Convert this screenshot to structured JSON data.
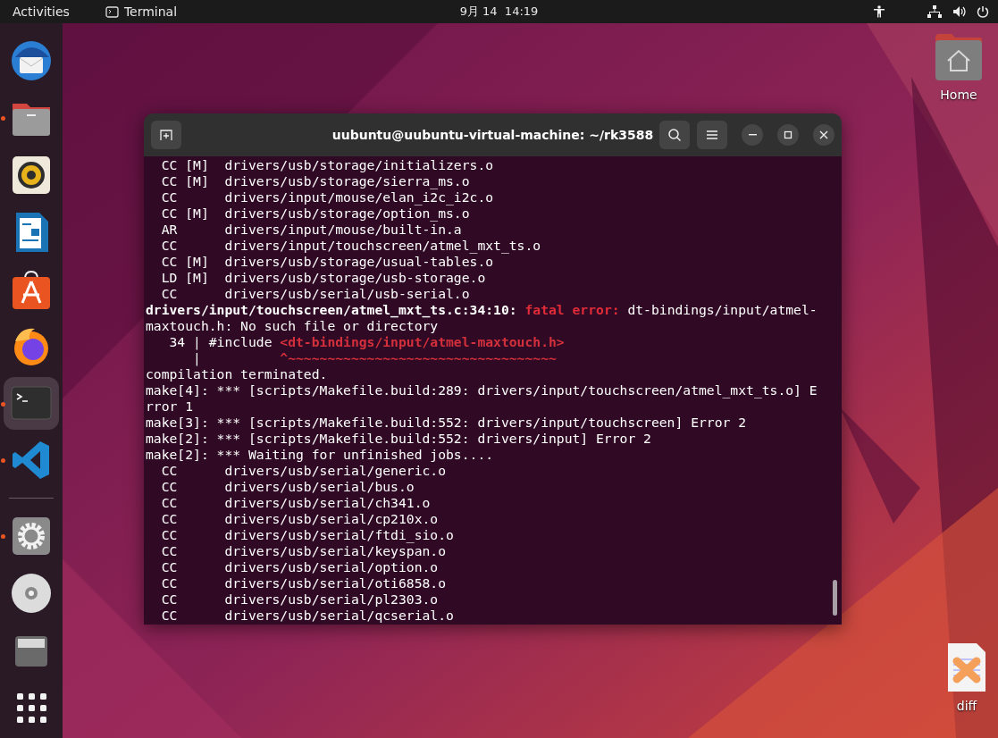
{
  "top_bar": {
    "activities": "Activities",
    "app": "Terminal",
    "clock": "9月 14  14:19"
  },
  "dock": [
    {
      "kind": "mail",
      "running": false,
      "selected": false
    },
    {
      "kind": "files",
      "running": true,
      "selected": false
    },
    {
      "kind": "speaker",
      "running": false,
      "selected": false
    },
    {
      "kind": "writer",
      "running": false,
      "selected": false
    },
    {
      "kind": "store",
      "running": false,
      "selected": false
    },
    {
      "kind": "browser",
      "running": false,
      "selected": false
    },
    {
      "kind": "terminal",
      "running": true,
      "selected": true
    },
    {
      "kind": "code",
      "running": true,
      "selected": false
    },
    {
      "kind": "separator"
    },
    {
      "kind": "settings",
      "running": true,
      "selected": false
    },
    {
      "kind": "disc",
      "running": false,
      "selected": false
    },
    {
      "kind": "drive",
      "running": false,
      "selected": false
    },
    {
      "kind": "apps",
      "running": false,
      "selected": false
    }
  ],
  "desktop_icons": [
    {
      "kind": "home-folder",
      "label": "Home"
    },
    {
      "kind": "diff-file",
      "label": "diff"
    }
  ],
  "terminal": {
    "title": "uubuntu@uubuntu-virtual-machine: ~/rk3588",
    "lines": [
      [
        {
          "kind": "plain",
          "text": "  CC [M]  drivers/usb/storage/initializers.o"
        }
      ],
      [
        {
          "kind": "plain",
          "text": "  CC [M]  drivers/usb/storage/sierra_ms.o"
        }
      ],
      [
        {
          "kind": "plain",
          "text": "  CC      drivers/input/mouse/elan_i2c_i2c.o"
        }
      ],
      [
        {
          "kind": "plain",
          "text": "  CC [M]  drivers/usb/storage/option_ms.o"
        }
      ],
      [
        {
          "kind": "plain",
          "text": "  AR      drivers/input/mouse/built-in.a"
        }
      ],
      [
        {
          "kind": "plain",
          "text": "  CC      drivers/input/touchscreen/atmel_mxt_ts.o"
        }
      ],
      [
        {
          "kind": "plain",
          "text": "  CC [M]  drivers/usb/storage/usual-tables.o"
        }
      ],
      [
        {
          "kind": "plain",
          "text": "  LD [M]  drivers/usb/storage/usb-storage.o"
        }
      ],
      [
        {
          "kind": "plain",
          "text": "  CC      drivers/usb/serial/usb-serial.o"
        }
      ],
      [
        {
          "kind": "bold",
          "text": "drivers/input/touchscreen/atmel_mxt_ts.c:34:10: "
        },
        {
          "kind": "error",
          "text": "fatal error:"
        },
        {
          "kind": "plain",
          "text": " dt-bindings/input/atmel-"
        }
      ],
      [
        {
          "kind": "plain",
          "text": "maxtouch.h: No such file or directory"
        }
      ],
      [
        {
          "kind": "plain",
          "text": "   34 | #include "
        },
        {
          "kind": "red",
          "text": "<dt-bindings/input/atmel-maxtouch.h>"
        }
      ],
      [
        {
          "kind": "plain",
          "text": "      |          "
        },
        {
          "kind": "red",
          "text": "^~~~~~~~~~~~~~~~~~~~~~~~~~~~~~~~~~~"
        }
      ],
      [
        {
          "kind": "plain",
          "text": "compilation terminated."
        }
      ],
      [
        {
          "kind": "plain",
          "text": "make[4]: *** [scripts/Makefile.build:289: drivers/input/touchscreen/atmel_mxt_ts.o] E"
        }
      ],
      [
        {
          "kind": "plain",
          "text": "rror 1"
        }
      ],
      [
        {
          "kind": "plain",
          "text": "make[3]: *** [scripts/Makefile.build:552: drivers/input/touchscreen] Error 2"
        }
      ],
      [
        {
          "kind": "plain",
          "text": "make[2]: *** [scripts/Makefile.build:552: drivers/input] Error 2"
        }
      ],
      [
        {
          "kind": "plain",
          "text": "make[2]: *** Waiting for unfinished jobs...."
        }
      ],
      [
        {
          "kind": "plain",
          "text": "  CC      drivers/usb/serial/generic.o"
        }
      ],
      [
        {
          "kind": "plain",
          "text": "  CC      drivers/usb/serial/bus.o"
        }
      ],
      [
        {
          "kind": "plain",
          "text": "  CC      drivers/usb/serial/ch341.o"
        }
      ],
      [
        {
          "kind": "plain",
          "text": "  CC      drivers/usb/serial/cp210x.o"
        }
      ],
      [
        {
          "kind": "plain",
          "text": "  CC      drivers/usb/serial/ftdi_sio.o"
        }
      ],
      [
        {
          "kind": "plain",
          "text": "  CC      drivers/usb/serial/keyspan.o"
        }
      ],
      [
        {
          "kind": "plain",
          "text": "  CC      drivers/usb/serial/option.o"
        }
      ],
      [
        {
          "kind": "plain",
          "text": "  CC      drivers/usb/serial/oti6858.o"
        }
      ],
      [
        {
          "kind": "plain",
          "text": "  CC      drivers/usb/serial/pl2303.o"
        }
      ],
      [
        {
          "kind": "plain",
          "text": "  CC      drivers/usb/serial/qcserial.o"
        }
      ]
    ]
  }
}
